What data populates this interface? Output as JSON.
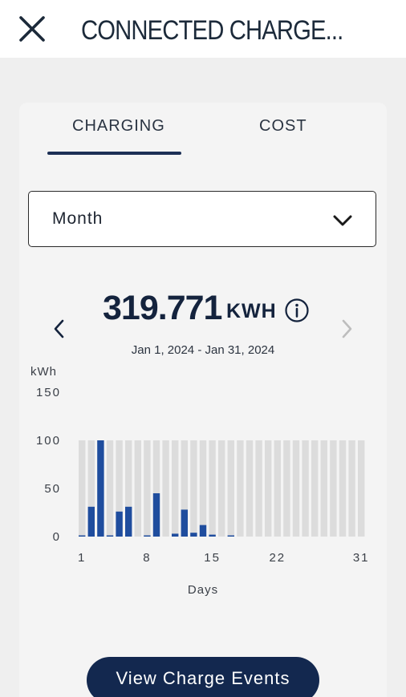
{
  "header": {
    "title": "CONNECTED CHARGE..."
  },
  "tabs": [
    {
      "label": "CHARGING",
      "active": true
    },
    {
      "label": "COST",
      "active": false
    }
  ],
  "period_select": {
    "value": "Month"
  },
  "summary": {
    "total": "319.771",
    "unit": "KWH",
    "date_range": "Jan 1, 2024 - Jan 31, 2024"
  },
  "colors": {
    "accent": "#1c2f55",
    "bar": "#1f4d9e",
    "bar_background": "#dcdcdc",
    "button": "#13284f"
  },
  "button": {
    "label": "View Charge Events"
  },
  "chart_data": {
    "type": "bar",
    "ylabel": "kWh",
    "xlabel": "Days",
    "ylim": [
      0,
      150
    ],
    "yticks": [
      "150",
      "100",
      "50",
      "0"
    ],
    "xticks": [
      {
        "day": 1,
        "label": "1"
      },
      {
        "day": 8,
        "label": "8"
      },
      {
        "day": 15,
        "label": "15"
      },
      {
        "day": 22,
        "label": "22"
      },
      {
        "day": 31,
        "label": "31"
      }
    ],
    "background_max": 100,
    "categories": [
      1,
      2,
      3,
      4,
      5,
      6,
      7,
      8,
      9,
      10,
      11,
      12,
      13,
      14,
      15,
      16,
      17,
      18,
      19,
      20,
      21,
      22,
      23,
      24,
      25,
      26,
      27,
      28,
      29,
      30,
      31
    ],
    "values": [
      1,
      31,
      100,
      1,
      26,
      31,
      0,
      1,
      45,
      0,
      3,
      28,
      4,
      12,
      2,
      0,
      1,
      0,
      0,
      0,
      0,
      0,
      0,
      0,
      0,
      0,
      0,
      0,
      0,
      0,
      0
    ]
  }
}
